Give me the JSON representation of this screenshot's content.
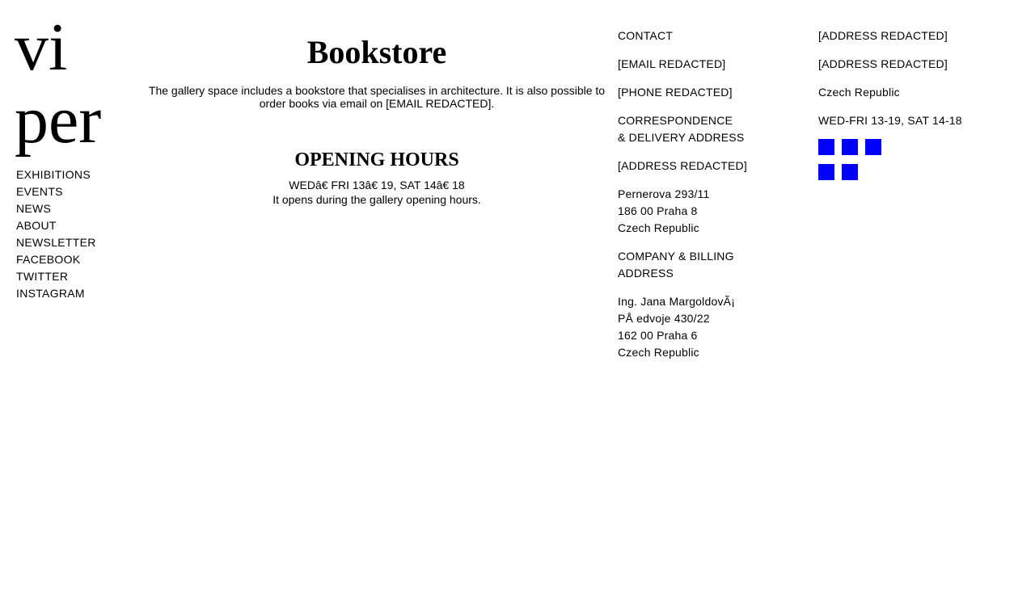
{
  "logo": {
    "line1": "vi",
    "line2": "per"
  },
  "nav": {
    "items": [
      {
        "label": "EXHIBITIONS"
      },
      {
        "label": "EVENTS"
      },
      {
        "label": "NEWS"
      },
      {
        "label": "ABOUT"
      },
      {
        "label": "NEWSLETTER"
      },
      {
        "label": "FACEBOOK"
      },
      {
        "label": "TWITTER"
      },
      {
        "label": "INSTAGRAM"
      }
    ]
  },
  "main": {
    "title": "Bookstore",
    "description": "The gallery space includes a bookstore that specialises in architecture. It is also possible to order books via email on [EMAIL REDACTED].",
    "hours_title": "OPENING HOURS",
    "hours_line": "WEDâ€   FRI 13â€   19, SAT 14â€   18",
    "hours_note": "It opens during the gallery opening hours."
  },
  "contact": {
    "heading": "CONTACT",
    "email": "[EMAIL REDACTED]",
    "phone": "[PHONE REDACTED]",
    "correspondence_heading_1": "CORRESPONDENCE",
    "correspondence_heading_2": "& DELIVERY ADDRESS",
    "correspondence_address": "[ADDRESS REDACTED]",
    "street": "Pernerova 293/11",
    "city": "186 00 Praha 8",
    "country": "Czech Republic",
    "billing_heading_1": "COMPANY & BILLING",
    "billing_heading_2": "ADDRESS",
    "billing_name": "Ing. Jana MargoldovÃ¡",
    "billing_street": "PÅ   edvoje 430/22",
    "billing_city": "162 00 Praha 6",
    "billing_country": "Czech Republic"
  },
  "address": {
    "line1": "[ADDRESS REDACTED]",
    "line2": "[ADDRESS REDACTED]",
    "country": "Czech Republic",
    "hours": "WED-FRI 13-19, SAT 14-18"
  },
  "socials": {
    "color": "#0000ff",
    "icons": [
      "social-icon",
      "social-icon",
      "social-icon",
      "social-icon",
      "social-icon"
    ]
  }
}
